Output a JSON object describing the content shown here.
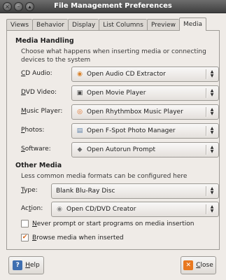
{
  "window": {
    "title": "File Management Preferences",
    "buttons": [
      "×",
      "–",
      "▴"
    ]
  },
  "tabs": [
    {
      "label": "Views",
      "active": false
    },
    {
      "label": "Behavior",
      "active": false
    },
    {
      "label": "Display",
      "active": false
    },
    {
      "label": "List Columns",
      "active": false
    },
    {
      "label": "Preview",
      "active": false
    },
    {
      "label": "Media",
      "active": true
    }
  ],
  "media_handling": {
    "title": "Media Handling",
    "description": "Choose what happens when inserting media or connecting devices to the system",
    "rows": [
      {
        "label_accel": "C",
        "label_rest": "D Audio:",
        "value": "Open Audio CD Extractor",
        "icon": "cd-audio-icon",
        "glyph": "◉",
        "icon_color": "#d9822b"
      },
      {
        "label_accel": "D",
        "label_rest": "VD Video:",
        "value": "Open Movie Player",
        "icon": "film-icon",
        "glyph": "▣",
        "icon_color": "#4a4a4a"
      },
      {
        "label_accel": "M",
        "label_rest": "usic Player:",
        "value": "Open Rhythmbox Music Player",
        "icon": "rhythmbox-icon",
        "glyph": "◎",
        "icon_color": "#e06a1b"
      },
      {
        "label_accel": "P",
        "label_rest": "hotos:",
        "value": "Open F-Spot Photo Manager",
        "icon": "f-spot-icon",
        "glyph": "▤",
        "icon_color": "#5b7fa8"
      },
      {
        "label_accel": "S",
        "label_rest": "oftware:",
        "value": "Open Autorun Prompt",
        "icon": "autorun-icon",
        "glyph": "◆",
        "icon_color": "#6b6b6b"
      }
    ]
  },
  "other_media": {
    "title": "Other Media",
    "description": "Less common media formats can be configured here",
    "type_label_accel": "T",
    "type_label_rest": "ype:",
    "type_value": "Blank Blu-Ray Disc",
    "action_label_pre": "Ac",
    "action_label_accel": "t",
    "action_label_rest": "ion:",
    "action_value": "Open CD/DVD Creator",
    "action_icon_color": "#8a8a8a"
  },
  "checkboxes": [
    {
      "accel": "N",
      "rest": "ever prompt or start programs on media insertion",
      "checked": false
    },
    {
      "accel": "B",
      "rest": "rowse media when inserted",
      "checked": true
    }
  ],
  "buttons": {
    "help": {
      "accel": "H",
      "rest": "elp",
      "icon_color": "#3f6fb0"
    },
    "close": {
      "accel": "C",
      "rest": "lose",
      "icon_color": "#e8781f"
    }
  },
  "colors": {
    "background": "#efebe7",
    "titlebar": "#4f4f4f",
    "accent": "#d6661c"
  }
}
